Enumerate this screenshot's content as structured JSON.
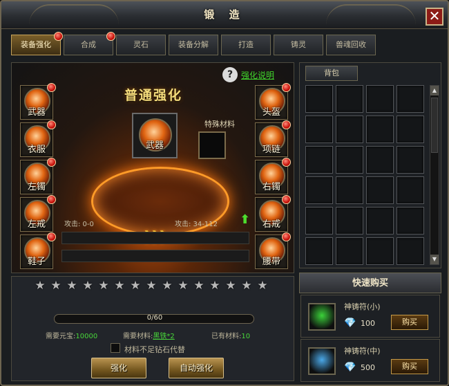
{
  "window": {
    "title": "锻 造"
  },
  "tabs": [
    {
      "label": "装备强化",
      "active": true,
      "alert": true
    },
    {
      "label": "合成",
      "active": false,
      "alert": true
    },
    {
      "label": "灵石",
      "active": false,
      "alert": false
    },
    {
      "label": "装备分解",
      "active": false,
      "alert": false
    },
    {
      "label": "打造",
      "active": false,
      "alert": false
    },
    {
      "label": "铸灵",
      "active": false,
      "alert": false
    },
    {
      "label": "兽魂回收",
      "active": false,
      "alert": false
    }
  ],
  "stage": {
    "title": "普通强化",
    "help_label": "强化说明",
    "center_slot": "武器",
    "special_material_label": "特殊材料",
    "attack_before": "攻击: 0-0",
    "attack_after": "攻击: 34-112",
    "left_slots": [
      "武器",
      "衣服",
      "左镯",
      "左戒",
      "鞋子"
    ],
    "right_slots": [
      "头盔",
      "项链",
      "右镯",
      "右戒",
      "腰带"
    ]
  },
  "bag": {
    "tab_label": "背包"
  },
  "enhance": {
    "stars_total": 15,
    "stars_filled": 0,
    "progress_text": "0/60",
    "progress_fraction": 0,
    "cost_gold_label": "需要元宝:",
    "cost_gold": "10000",
    "cost_material_label": "需要材料:",
    "cost_material": "黑铁*2",
    "owned_material_label": "已有材料:",
    "owned_material": "10",
    "checkbox_label": "材料不足钻石代替",
    "enhance_button": "强化",
    "auto_enhance_button": "自动强化"
  },
  "quick_buy": {
    "header": "快速购买",
    "items": [
      {
        "name": "神铸符(小)",
        "price": "100",
        "buy_label": "购买",
        "color": "#3bd23a"
      },
      {
        "name": "神铸符(中)",
        "price": "500",
        "buy_label": "购买",
        "color": "#4aa8e8"
      }
    ]
  }
}
